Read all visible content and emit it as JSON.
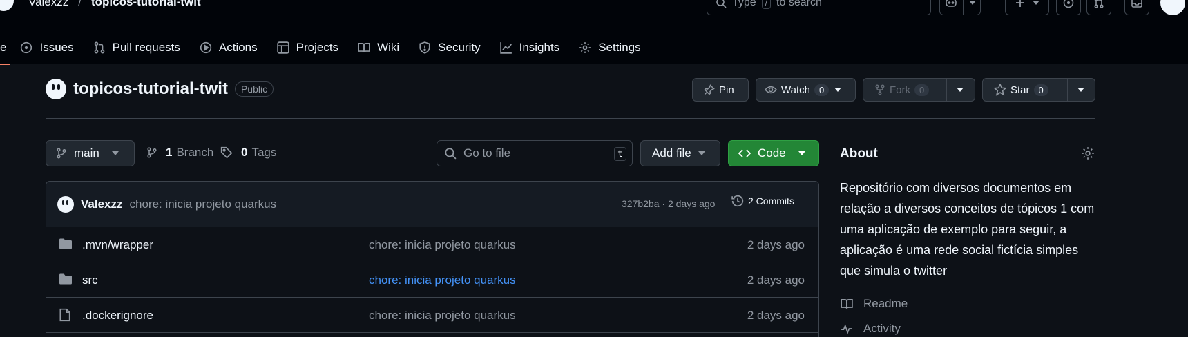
{
  "header": {
    "owner": "Valexzz",
    "separator": "/",
    "repo": "topicos-tutorial-twit",
    "search_placeholder_prefix": "Type",
    "search_key": "/",
    "search_placeholder_suffix": "to search"
  },
  "tabs": [
    {
      "label": "e",
      "icon": "code-icon"
    },
    {
      "label": "Issues",
      "icon": "issue-icon"
    },
    {
      "label": "Pull requests",
      "icon": "pull-request-icon"
    },
    {
      "label": "Actions",
      "icon": "play-icon"
    },
    {
      "label": "Projects",
      "icon": "table-icon"
    },
    {
      "label": "Wiki",
      "icon": "book-icon"
    },
    {
      "label": "Security",
      "icon": "shield-icon"
    },
    {
      "label": "Insights",
      "icon": "graph-icon"
    },
    {
      "label": "Settings",
      "icon": "gear-icon"
    }
  ],
  "repo_header": {
    "name": "topicos-tutorial-twit",
    "visibility": "Public",
    "pin_label": "Pin",
    "watch_label": "Watch",
    "watch_count": "0",
    "fork_label": "Fork",
    "fork_count": "0",
    "star_label": "Star",
    "star_count": "0"
  },
  "toolbar": {
    "branch": "main",
    "branch_count": "1",
    "branch_label": "Branch",
    "tag_count": "0",
    "tag_label": "Tags",
    "goto_placeholder": "Go to file",
    "goto_key": "t",
    "add_file_label": "Add file",
    "code_label": "Code"
  },
  "latest_commit": {
    "author": "Valexzz",
    "message": "chore: inicia projeto quarkus",
    "meta": "327b2ba · 2 days ago",
    "commits_label": "2 Commits"
  },
  "files": [
    {
      "name": ".mvn/wrapper",
      "type": "folder",
      "message": "chore: inicia projeto quarkus",
      "date": "2 days ago",
      "link": false
    },
    {
      "name": "src",
      "type": "folder",
      "message": "chore: inicia projeto quarkus",
      "date": "2 days ago",
      "link": true
    },
    {
      "name": ".dockerignore",
      "type": "file",
      "message": "chore: inicia projeto quarkus",
      "date": "2 days ago",
      "link": false
    }
  ],
  "about": {
    "title": "About",
    "description": "Repositório com diversos documentos em relação a diversos conceitos de tópicos 1 com uma aplicação de exemplo para seguir, a aplicação é uma rede social fictícia simples que simula o twitter",
    "links": [
      {
        "label": "Readme",
        "icon": "book-icon"
      },
      {
        "label": "Activity",
        "icon": "pulse-icon"
      }
    ]
  },
  "colors": {
    "background": "#0d1117",
    "header_bg": "#010409",
    "accent_tab": "#f78166",
    "code_button": "#238636",
    "link": "#4493f8"
  }
}
